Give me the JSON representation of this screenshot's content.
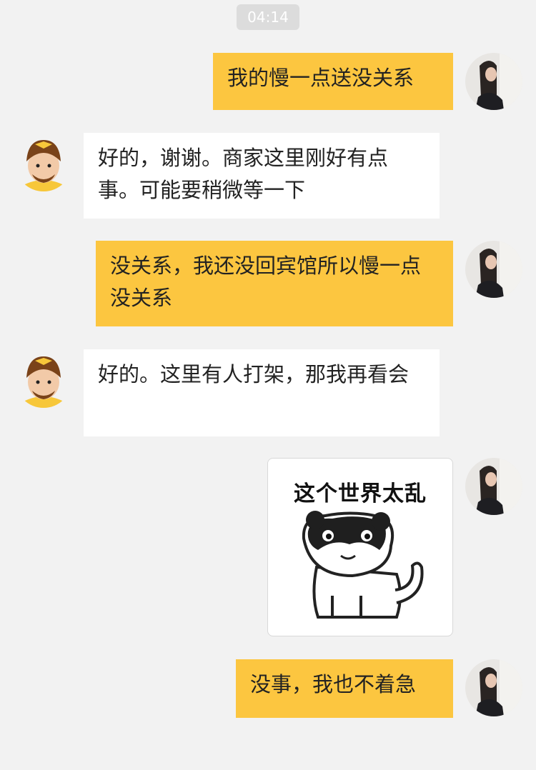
{
  "timestamp": "04:14",
  "colors": {
    "background": "#f2f2f2",
    "outgoing_bubble": "#fcc640",
    "incoming_bubble": "#ffffff"
  },
  "messages": [
    {
      "sender": "me",
      "text": "我的慢一点送没关系"
    },
    {
      "sender": "courier",
      "text": "好的，谢谢。商家这里刚好有点事。可能要稍微等一下"
    },
    {
      "sender": "me",
      "text": "没关系，我还没回宾馆所以慢一点没关系"
    },
    {
      "sender": "courier",
      "text": "好的。这里有人打架，那我再看会"
    },
    {
      "sender": "me",
      "type": "sticker",
      "caption": "这个世界太乱",
      "icon": "raccoon-cat-sticker"
    },
    {
      "sender": "me",
      "text": "没事，我也不着急"
    }
  ],
  "avatars": {
    "me": "user-photo-avatar",
    "courier": "courier-cartoon-avatar"
  }
}
